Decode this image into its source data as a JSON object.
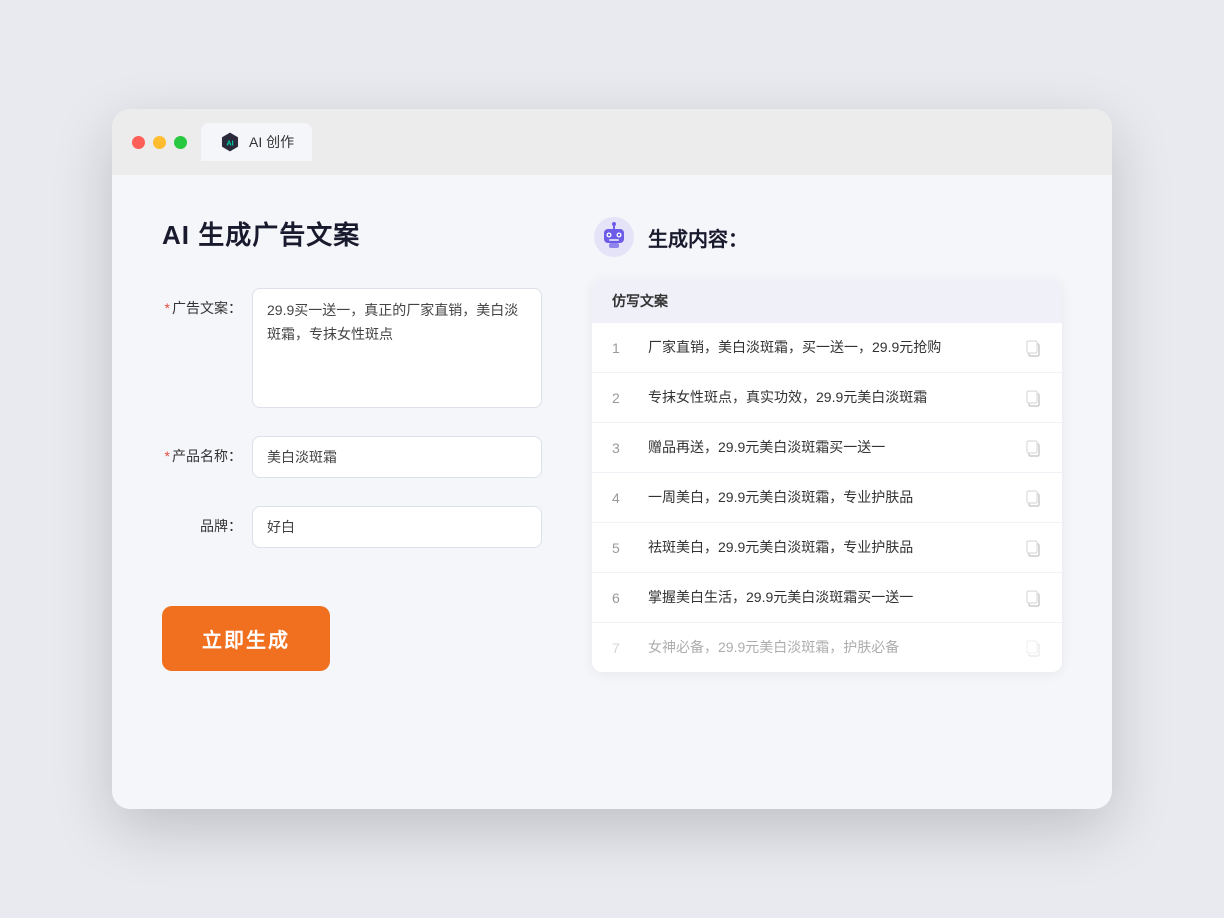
{
  "browser": {
    "tab_label": "AI 创作"
  },
  "page": {
    "title": "AI 生成广告文案",
    "result_title": "生成内容："
  },
  "form": {
    "ad_copy_label": "广告文案：",
    "ad_copy_required": "*",
    "ad_copy_value": "29.9买一送一，真正的厂家直销，美白淡斑霜，专抹女性斑点",
    "product_name_label": "产品名称：",
    "product_name_required": "*",
    "product_name_value": "美白淡斑霜",
    "brand_label": "品牌：",
    "brand_value": "好白",
    "generate_button": "立即生成"
  },
  "result": {
    "column_header": "仿写文案",
    "items": [
      {
        "num": "1",
        "text": "厂家直销，美白淡斑霜，买一送一，29.9元抢购",
        "faded": false
      },
      {
        "num": "2",
        "text": "专抹女性斑点，真实功效，29.9元美白淡斑霜",
        "faded": false
      },
      {
        "num": "3",
        "text": "赠品再送，29.9元美白淡斑霜买一送一",
        "faded": false
      },
      {
        "num": "4",
        "text": "一周美白，29.9元美白淡斑霜，专业护肤品",
        "faded": false
      },
      {
        "num": "5",
        "text": "祛斑美白，29.9元美白淡斑霜，专业护肤品",
        "faded": false
      },
      {
        "num": "6",
        "text": "掌握美白生活，29.9元美白淡斑霜买一送一",
        "faded": false
      },
      {
        "num": "7",
        "text": "女神必备，29.9元美白淡斑霜，护肤必备",
        "faded": true
      }
    ]
  },
  "colors": {
    "accent_orange": "#f07020",
    "required_red": "#e74c3c",
    "text_dark": "#1a1a2e",
    "border": "#dde0e8"
  }
}
